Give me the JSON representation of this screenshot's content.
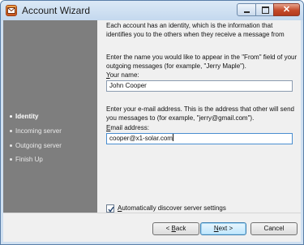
{
  "window": {
    "title": "Account Wizard",
    "close_glyph": "✕"
  },
  "sidebar": {
    "items": [
      {
        "label": "Identity",
        "active": true
      },
      {
        "label": "Incoming server",
        "active": false
      },
      {
        "label": "Outgoing server",
        "active": false
      },
      {
        "label": "Finish Up",
        "active": false
      }
    ]
  },
  "content": {
    "intro": "Each account has an identity, which is the information that identifies you to the others when they receive a message from",
    "name_help": "Enter the name you would like to appear in the \"From\" field of your outgoing messages (for example, \"Jerry Maple\").",
    "name_label_prefix": "",
    "name_label_access": "Y",
    "name_label_rest": "our name:",
    "name_value": "John Cooper",
    "email_help": "Enter your e-mail address. This is the address that other will send you messages to (for example, \"jerry@gmail.com\").",
    "email_label_prefix": "",
    "email_label_access": "E",
    "email_label_rest": "mail address:",
    "email_value": "cooper@x1-solar.com",
    "auto_discover_label_access": "A",
    "auto_discover_label_rest": "utomatically discover server settings",
    "auto_discover_checked": true
  },
  "buttons": {
    "back_prefix": "< ",
    "back_access": "B",
    "back_rest": "ack",
    "next_access": "N",
    "next_rest": "ext >",
    "cancel": "Cancel"
  }
}
